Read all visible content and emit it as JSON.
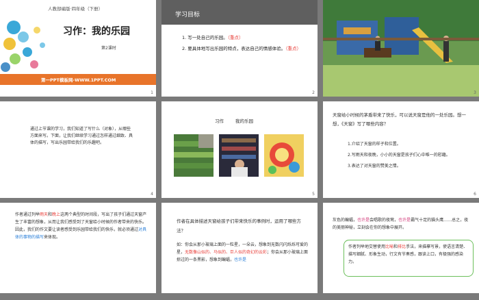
{
  "slides": [
    {
      "num": "1",
      "publisher": "人教部编版·四年级（下册）",
      "title": "习作：我的乐园",
      "lesson": "第2课时",
      "banner": "第一PPT模板网-WWW.1PPT.COM"
    },
    {
      "num": "2",
      "header": "学习目标",
      "goals": [
        {
          "text": "1. 写一处自己的乐园。",
          "tag": "（重点）"
        },
        {
          "text": "2. 要具体地写出乐园的特点，表达自己的情感体验。",
          "tag": "（重点）"
        }
      ]
    },
    {
      "num": "3"
    },
    {
      "num": "4",
      "para": "通过上节课的学习，我们知道了写什么（对象），从哪些方面来写。下面，让我们继续学习通过怎样通过细致、具体的描写，写出乐园带给我们的乐趣吧。"
    },
    {
      "num": "5",
      "sub1": "习作",
      "sub2": "我的乐园"
    },
    {
      "num": "6",
      "intro": "天窗给小时候的茅盾带来了快乐，可以说天窗是他的一处乐园。想一想，《天窗》写了哪些内容？",
      "items": [
        "1.介绍了天窗的样子和位置。",
        "2.写雨天和夜晚，小小的天窗是孩子们心中唯一的慰藉。",
        "3.表达了对天窗的赞美之情。"
      ]
    },
    {
      "num": "7",
      "p1": "作者通过列举",
      "p1r": "雨天",
      "p1b": "和",
      "p1c": "晚上",
      "p1d": "这两个典型的时间段，写出了孩子们通过天窗产生了丰富的想象，从而让我们感受到了天窗给小时候的作者带来的快乐。",
      "p2": "因此，我们的作文要让读者感受到乐园带给我们的快乐，就必须通过",
      "p2r": "对具体的事物的描写",
      "p2e": "来体现。"
    },
    {
      "num": "8",
      "q": "作者在具体描述天窗给孩子们带来快乐的事例时，运用了哪些方法？",
      "b1": "如：你会从那小玻璃上面的一粒星，一朵云，想象到无数闪闪烁烁可爱的星，",
      "b1r": "无数像山似的、马似的、巨人似的奇幻的云彩",
      "b2": "；你会从那小玻璃上面掠过的一条黑影，想象到蝙蝠，",
      "b2r": "也许是"
    },
    {
      "num": "9",
      "top1": "灰色的蝙蝠，",
      "top1b": "也许是",
      "top2": "会唱歌的夜莺，",
      "top2b": "也许是",
      "top3": "霸气十足的猫头鹰……总之，夜的美丽神秘，立刻会在你的想象中展开。",
      "box1": "作者列举地交替使用",
      "box1r": "比喻",
      "box1b": "和",
      "box1c": "排比",
      "box2": "手法，来描摹写景，使语言清楚、描写细腻、形象生动，行文有节奏感，跟读上口，有极强的感染力。"
    }
  ]
}
